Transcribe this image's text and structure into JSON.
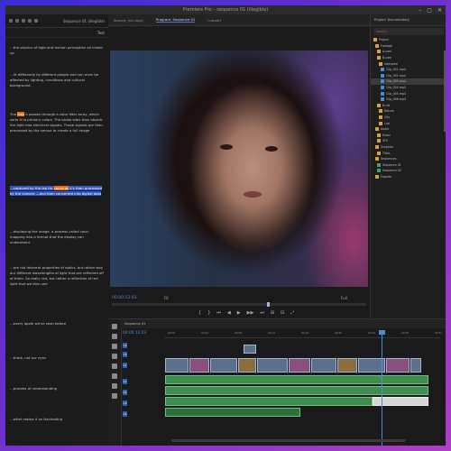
{
  "window": {
    "title": "Premiere Pro – sequence 01 (illegible)",
    "controls": [
      "–",
      "▢",
      "✕"
    ]
  },
  "left_panel": {
    "header": "Sequence 01 (illegible)",
    "tab_label": "Text",
    "paragraphs": [
      {
        "text": "…the physics of light and human perception all mixed up"
      },
      {
        "text": "…lit differently by different people and can even be affected by lighting, conditions and cultural background."
      },
      {
        "pre": "The ",
        "hl": "lens",
        "post": " it passes through a color filter array, which sorts it to primary colors. The photo sites then absorb the light into electrical signals. These signals are then processed by the sensor to create a full image"
      },
      {
        "pre": "…captured by the lap for ",
        "hl": "cameras",
        "post": " it's then processed by the camera —and then converted into digital data"
      },
      {
        "text": "…displaying the image, a process called color mapping into a format that the display can understand."
      },
      {
        "text": "…are not inherent properties of optics, but rather way our different wavelengths of light that are reflected off of them. So really red, but rather a reflection of red light that we then see"
      },
      {
        "text": "…every apple we've seen before"
      },
      {
        "text": "…there, not our eyes"
      },
      {
        "text": "…process of understanding"
      },
      {
        "text": "…what makes it so fascinating"
      }
    ]
  },
  "monitor": {
    "tabs": [
      "Source: (no clips)",
      "Program: Sequence 01",
      "Lumetri"
    ],
    "active_tab": 1,
    "timecode": "00:00:12:03",
    "fit": "Fit",
    "quality": "Full",
    "controls": [
      "{",
      "}",
      "⏮",
      "◀",
      "▶",
      "▶▶",
      "⏭",
      "⊞",
      "⊟",
      "⤢"
    ]
  },
  "project": {
    "tab": "Project: Documentary",
    "search_placeholder": "Search",
    "items": [
      {
        "label": "Project",
        "color": "#d6a33c"
      },
      {
        "label": "Footage",
        "color": "#d6a33c"
      },
      {
        "label": "A-cam",
        "color": "#d6a33c"
      },
      {
        "label": "B-cam",
        "color": "#d6a33c"
      },
      {
        "label": "Interview",
        "color": "#d6a33c"
      },
      {
        "label": "Clip_001.mp4",
        "color": "#4a8bd6"
      },
      {
        "label": "Clip_002.mp4",
        "color": "#4a8bd6"
      },
      {
        "label": "Clip_003.mp4",
        "color": "#4a8bd6"
      },
      {
        "label": "Clip_004.mp4",
        "color": "#4a8bd6"
      },
      {
        "label": "Clip_005.mp4",
        "color": "#4a8bd6"
      },
      {
        "label": "Clip_006.mp4",
        "color": "#4a8bd6"
      },
      {
        "label": "B-roll",
        "color": "#d6a33c"
      },
      {
        "label": "Nature",
        "color": "#d6a33c"
      },
      {
        "label": "City",
        "color": "#d6a33c"
      },
      {
        "label": "Lab",
        "color": "#d6a33c"
      },
      {
        "label": "Audio",
        "color": "#d6a33c"
      },
      {
        "label": "Music",
        "color": "#d6a33c"
      },
      {
        "label": "SFX",
        "color": "#d6a33c"
      },
      {
        "label": "Graphics",
        "color": "#d6a33c"
      },
      {
        "label": "Titles",
        "color": "#d6a33c"
      },
      {
        "label": "Sequences",
        "color": "#d6a33c"
      },
      {
        "label": "Sequence 01",
        "color": "#3fa36a"
      },
      {
        "label": "Sequence 02",
        "color": "#3fa36a"
      },
      {
        "label": "Exports",
        "color": "#d6a33c"
      }
    ]
  },
  "timeline": {
    "tab": "Sequence 01",
    "timecode": "00:00:12:03",
    "ruler": [
      "00:00",
      "00:04",
      "00:08",
      "00:12",
      "00:16",
      "00:20",
      "00:24",
      "00:28",
      "00:32"
    ],
    "tracks": [
      "V3",
      "V2",
      "V1",
      "A1",
      "A2",
      "A3",
      "A4"
    ]
  }
}
